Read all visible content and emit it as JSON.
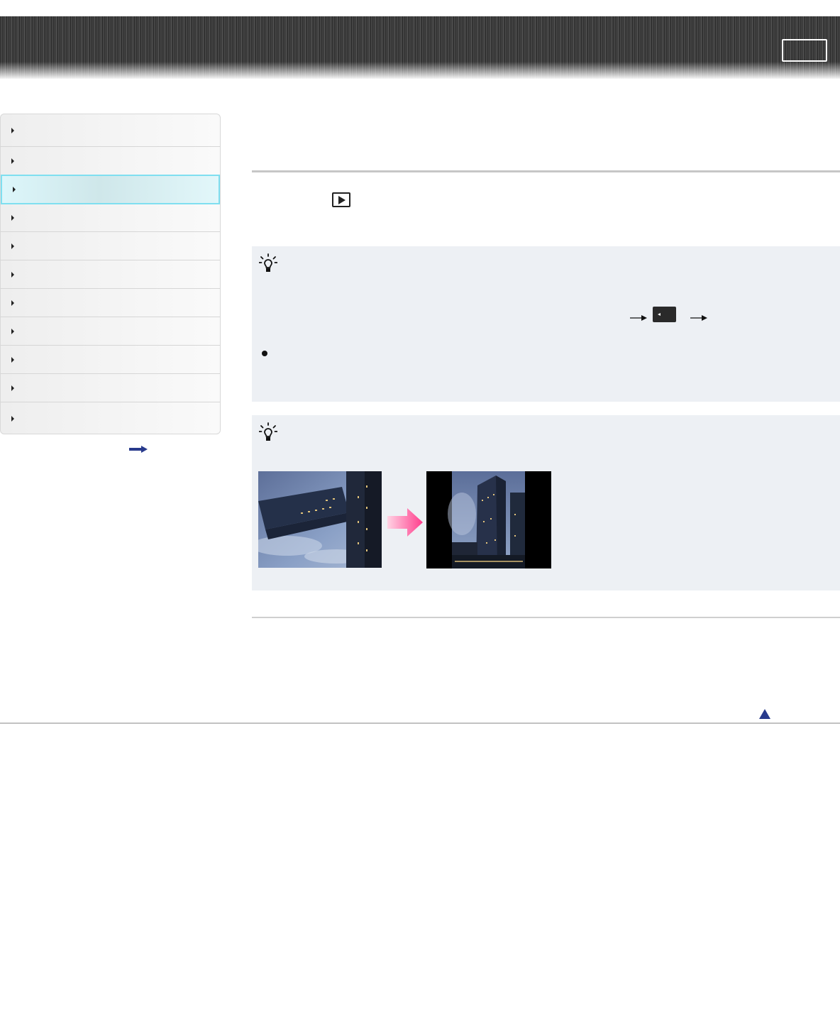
{
  "header": {
    "button_label": ""
  },
  "sidebar": {
    "items": [
      {
        "label": ""
      },
      {
        "label": ""
      },
      {
        "label": ""
      },
      {
        "label": ""
      },
      {
        "label": ""
      },
      {
        "label": ""
      },
      {
        "label": ""
      },
      {
        "label": ""
      },
      {
        "label": ""
      },
      {
        "label": ""
      },
      {
        "label": ""
      }
    ],
    "active_index": 2
  },
  "icons": {
    "playback": "play-icon",
    "tip": "lightbulb-icon",
    "arrow": "right-arrow-icon",
    "menu_tab": "menu-tab-icon",
    "pink_arrow": "pink-arrow-icon",
    "page_top": "up-triangle-icon"
  },
  "colors": {
    "active_item_border": "#7fdff0",
    "tip_background": "#edf0f4",
    "accent_arrow": "#ff4f95",
    "link_blue": "#283a8c"
  }
}
